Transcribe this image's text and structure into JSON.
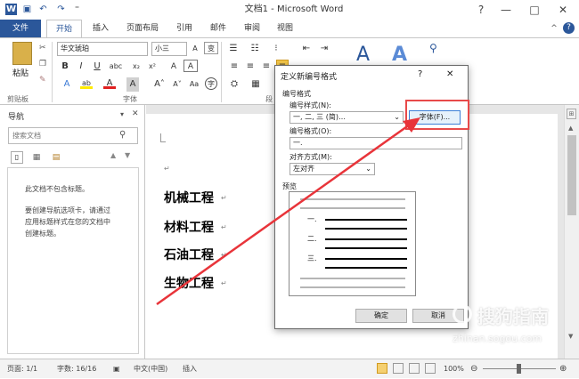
{
  "window": {
    "title": "文档1 - Microsoft Word",
    "help": "?",
    "controls": [
      "—",
      "□",
      "✕"
    ]
  },
  "quick_access": [
    "word-logo",
    "save",
    "undo",
    "redo",
    "customize"
  ],
  "ribbon": {
    "file_tab": "文件",
    "tabs": [
      "开始",
      "插入",
      "页面布局",
      "引用",
      "邮件",
      "审阅",
      "视图"
    ],
    "active_tab": "开始",
    "clipboard": {
      "paste": "粘贴",
      "group_label": "剪贴板"
    },
    "font": {
      "name": "华文琥珀",
      "size": "小三",
      "group_label": "字体"
    },
    "paragraph_label": "段",
    "styles": [
      {
        "glyph": "A"
      },
      {
        "glyph": "A"
      }
    ]
  },
  "nav": {
    "title": "导航",
    "search_placeholder": "搜索文档",
    "empty_title": "此文档不包含标题。",
    "help_lines": [
      "要创建导航选项卡，请通过",
      "应用标题样式在您的文档中",
      "创建标题。"
    ]
  },
  "document": {
    "headings": [
      "机械工程",
      "材料工程",
      "石油工程",
      "生物工程"
    ]
  },
  "dialog": {
    "title": "定义新编号格式",
    "help": "?",
    "close": "✕",
    "section_number_format": "编号格式",
    "style_label": "编号样式(N):",
    "style_value": "一, 二, 三 (简)…",
    "font_button": "字体(F)...",
    "format_label": "编号格式(O):",
    "format_value": "一.",
    "align_label": "对齐方式(M):",
    "align_value": "左对齐",
    "preview_label": "预览",
    "preview_items": [
      "一.",
      "二.",
      "三."
    ],
    "ok": "确定",
    "cancel": "取消"
  },
  "status": {
    "page": "页面: 1/1",
    "words": "字数: 16/16",
    "language": "中文(中国)",
    "mode": "插入",
    "zoom": "100%"
  },
  "watermark": {
    "text": "搜狗指南",
    "sub": "zhinan.sogou.com"
  },
  "colors": {
    "accent": "#2b579a",
    "arrow": "#e8343a",
    "highlight": "#e84a4a"
  }
}
